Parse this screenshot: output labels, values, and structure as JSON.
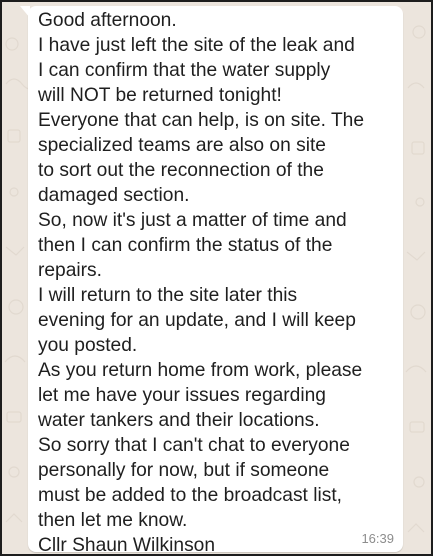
{
  "message": {
    "lines": [
      "Good afternoon.",
      "I have just left the site of the leak and",
      "I can confirm that the water supply",
      "will NOT be returned tonight!",
      "Everyone that can help, is on site. The",
      "specialized teams are also on site",
      "to sort out the reconnection of the",
      "damaged section.",
      "So, now it's just a matter of time and",
      "then I can confirm the status of the",
      "repairs.",
      "I will return to the site later this",
      "evening for an update, and I will keep",
      "you posted.",
      "As you return home from work, please",
      "let me have your issues regarding",
      "water tankers and their locations.",
      "So sorry that I can't chat to everyone",
      "personally for now, but if someone",
      "must be added to the broadcast list,",
      "then let me know.",
      "Cllr Shaun Wilkinson"
    ],
    "time": "16:39"
  },
  "colors": {
    "background": "#ece5dd",
    "bubble": "#ffffff",
    "text": "#1f1f1f",
    "timestamp": "#8d8d8d"
  }
}
